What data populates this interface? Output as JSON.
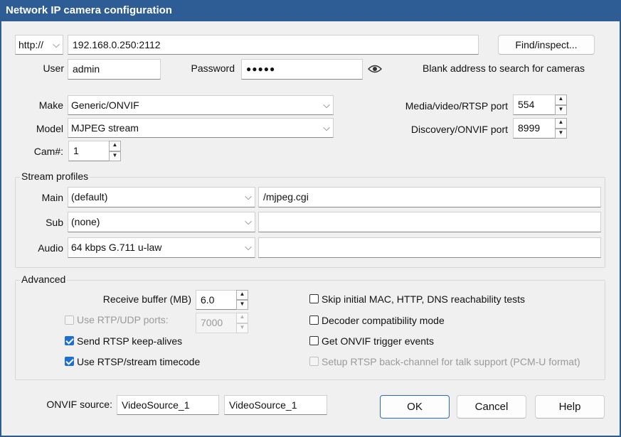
{
  "window": {
    "title": "Network IP camera configuration"
  },
  "address": {
    "scheme": "http://",
    "value": "192.168.0.250:2112",
    "find_button": "Find/inspect...",
    "hint": "Blank address to search for cameras"
  },
  "credentials": {
    "user_label": "User",
    "user_value": "admin",
    "password_label": "Password",
    "password_value": "●●●●●"
  },
  "device": {
    "make_label": "Make",
    "make_value": "Generic/ONVIF",
    "model_label": "Model",
    "model_value": "MJPEG stream",
    "cam_label": "Cam#:",
    "cam_value": "1",
    "media_port_label": "Media/video/RTSP port",
    "media_port_value": "554",
    "discovery_port_label": "Discovery/ONVIF port",
    "discovery_port_value": "8999"
  },
  "stream_profiles": {
    "title": "Stream profiles",
    "main_label": "Main",
    "main_value": "(default)",
    "main_path": "/mjpeg.cgi",
    "sub_label": "Sub",
    "sub_value": "(none)",
    "sub_path": "",
    "audio_label": "Audio",
    "audio_value": "64 kbps G.711 u-law",
    "audio_path": ""
  },
  "advanced": {
    "title": "Advanced",
    "receive_buffer_label": "Receive buffer (MB)",
    "receive_buffer_value": "6.0",
    "rtp_udp_label": "Use RTP/UDP ports:",
    "rtp_udp_value": "7000",
    "keepalive_label": "Send RTSP keep-alives",
    "timecode_label": "Use RTSP/stream timecode",
    "skip_label": "Skip initial MAC, HTTP, DNS reachability tests",
    "decoder_label": "Decoder compatibility mode",
    "onvif_events_label": "Get ONVIF trigger events",
    "backchannel_label": "Setup RTSP back-channel for talk support (PCM-U format)",
    "checked": {
      "rtp_udp": false,
      "keepalive": true,
      "timecode": true,
      "skip": false,
      "decoder": false,
      "onvif_events": false,
      "backchannel": false
    }
  },
  "footer": {
    "onvif_source_label": "ONVIF source:",
    "onvif_source_1": "VideoSource_1",
    "onvif_source_2": "VideoSource_1",
    "ok": "OK",
    "cancel": "Cancel",
    "help": "Help"
  },
  "colors": {
    "title_bar": "#2e5d95",
    "accent": "#1e6fd0"
  }
}
